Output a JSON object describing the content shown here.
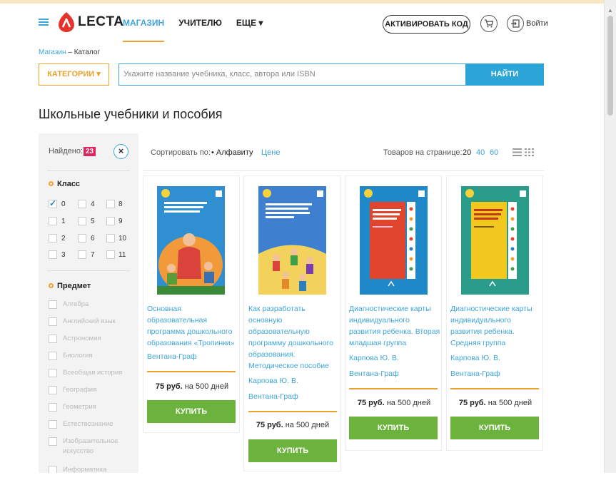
{
  "header": {
    "logo_text": "LECTA",
    "nav": [
      {
        "label": "МАГАЗИН"
      },
      {
        "label": "УЧИТЕЛЮ"
      },
      {
        "label": "ЕЩЕ ▾"
      }
    ],
    "activate_label": "АКТИВИРОВАТЬ КОД",
    "login_label": "Войти",
    "accent_color": "#3da5d9",
    "brand_color": "#e5342c"
  },
  "breadcrumb": {
    "root": "Магазин",
    "separator": " – ",
    "current": "Каталог"
  },
  "search": {
    "categories_label": "КАТЕГОРИИ ▾",
    "placeholder": "Укажите название учебника, класс, автора или ISBN",
    "button_label": "НАЙТИ"
  },
  "page_title": "Школьные учебники и пособия",
  "sidebar": {
    "found_label": "Найдено:",
    "found_count": "23",
    "reset_label": "×",
    "class_title": "Класс",
    "classes": [
      {
        "label": "0",
        "checked": true
      },
      {
        "label": "4",
        "checked": false
      },
      {
        "label": "8",
        "checked": false
      },
      {
        "label": "1",
        "checked": false
      },
      {
        "label": "5",
        "checked": false
      },
      {
        "label": "9",
        "checked": false
      },
      {
        "label": "2",
        "checked": false
      },
      {
        "label": "6",
        "checked": false
      },
      {
        "label": "10",
        "checked": false
      },
      {
        "label": "3",
        "checked": false
      },
      {
        "label": "7",
        "checked": false
      },
      {
        "label": "11",
        "checked": false
      }
    ],
    "subject_title": "Предмет",
    "subjects": [
      "Алгебра",
      "Английский язык",
      "Астрономия",
      "Биология",
      "Всеобщая история",
      "География",
      "Геометрия",
      "Естествознание",
      "Изобразительное искусство",
      "Информатика"
    ]
  },
  "sortbar": {
    "sort_label": "Сортировать по:",
    "sort_alpha": "• Алфавиту",
    "sort_price": "Цене",
    "perpage_label": "Товаров на странице:",
    "perpage": [
      "20",
      "40",
      "60"
    ]
  },
  "products": [
    {
      "title": "Основная образовательная программа дошкольного образования «Тропинки»",
      "author": "",
      "publisher": "Вентана-Граф",
      "price": "75 руб.",
      "term": "на 500 дней",
      "buy_label": "КУПИТЬ",
      "cover_color": "#2f8fd1"
    },
    {
      "title": "Как разработать основную образовательную программу дошкольного образования. Методическое пособие",
      "author": "Карпова Ю. В.",
      "publisher": "Вентана-Граф",
      "price": "75 руб.",
      "term": "на 500 дней",
      "buy_label": "КУПИТЬ",
      "cover_color": "#3f7fd0"
    },
    {
      "title": "Диагностические карты индивидуального развития ребенка. Вторая младшая группа",
      "author": "Карпова Ю. В.",
      "publisher": "Вентана-Граф",
      "price": "75 руб.",
      "term": "на 500 дней",
      "buy_label": "КУПИТЬ",
      "cover_color": "#1e88c8"
    },
    {
      "title": "Диагностические карты индивидуального развития ребенка. Средняя группа",
      "author": "Карпова Ю. В.",
      "publisher": "Вентана-Граф",
      "price": "75 руб.",
      "term": "на 500 дней",
      "buy_label": "КУПИТЬ",
      "cover_color": "#2a9c8a"
    }
  ]
}
